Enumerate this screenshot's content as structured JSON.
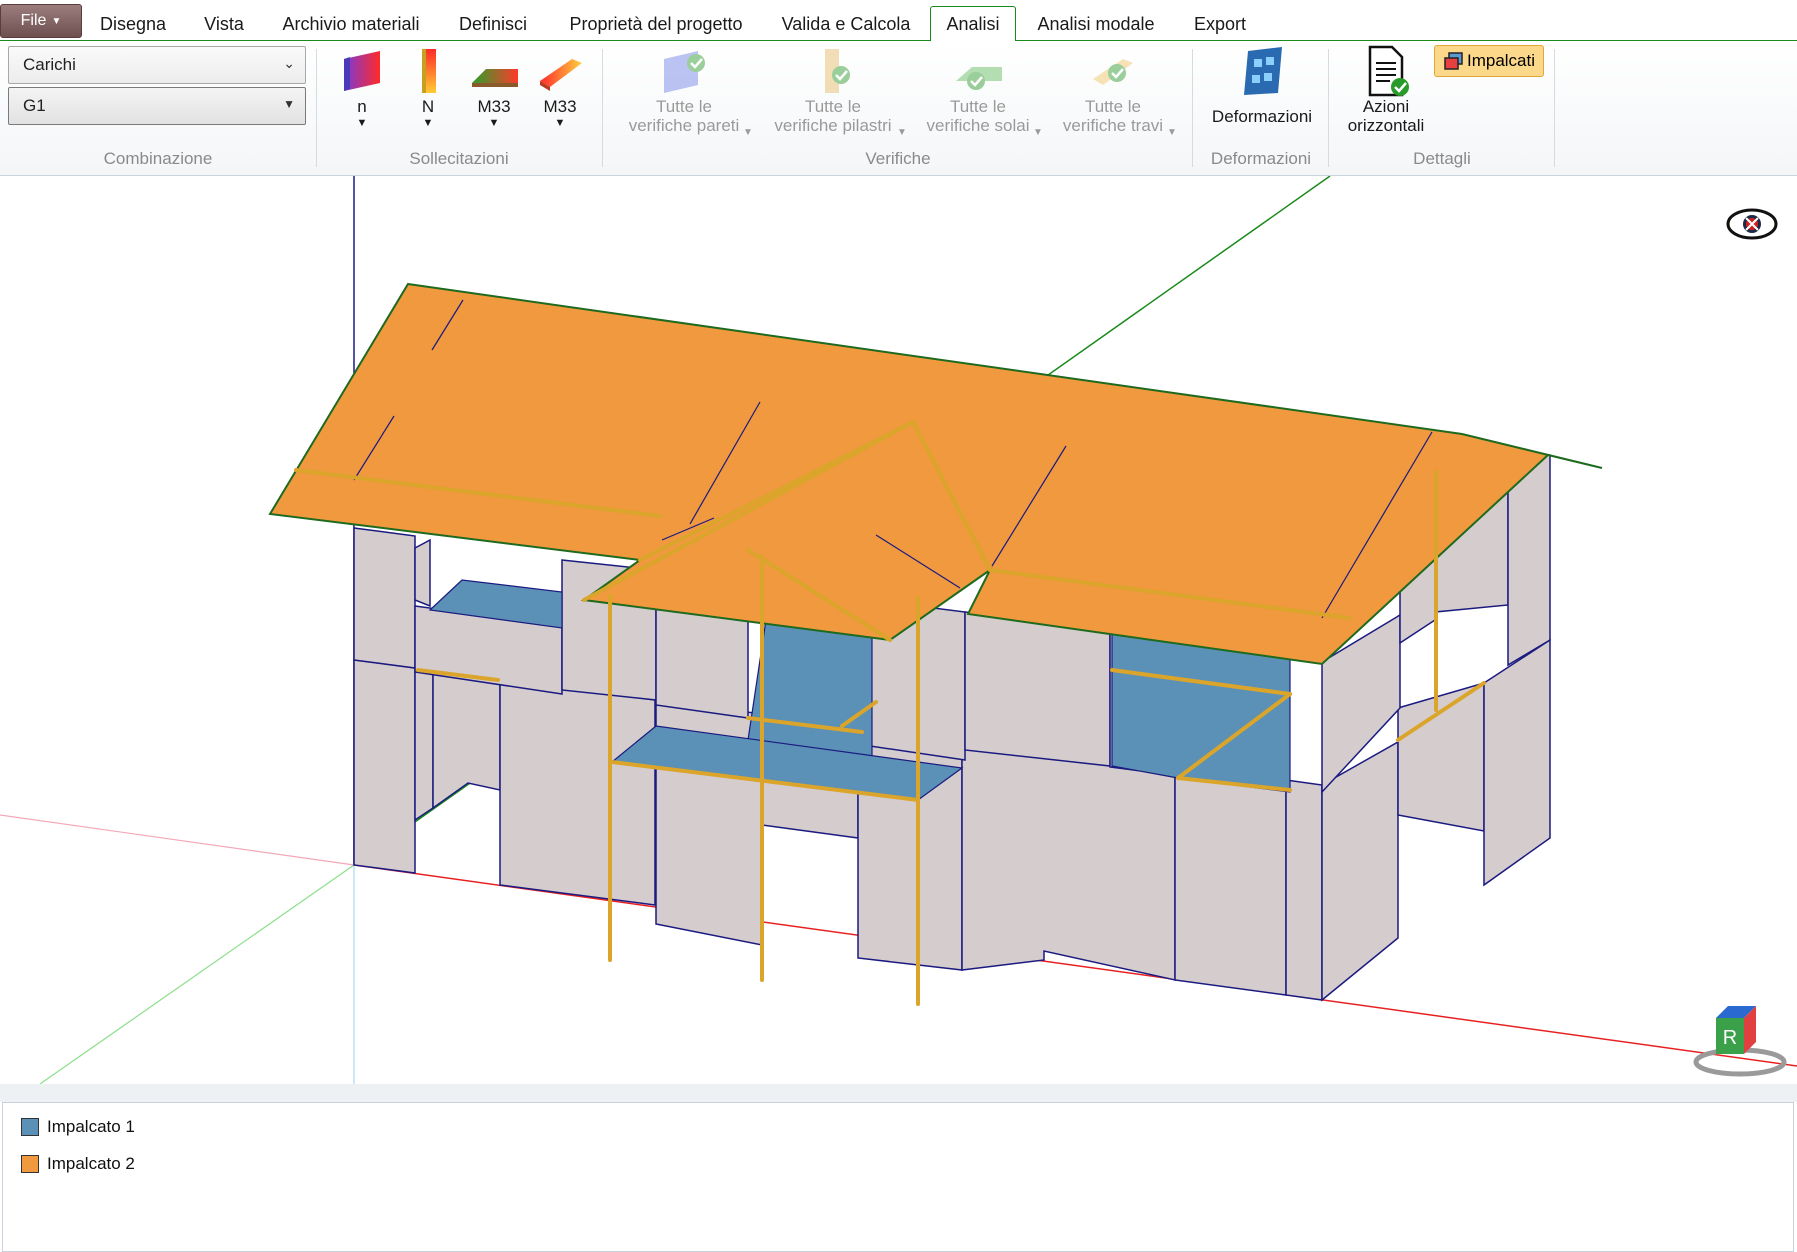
{
  "tabs": {
    "file_label": "File",
    "items": [
      {
        "label": "Disegna"
      },
      {
        "label": "Vista"
      },
      {
        "label": "Archivio materiali"
      },
      {
        "label": "Definisci"
      },
      {
        "label": "Proprietà del progetto"
      },
      {
        "label": "Valida e Calcola"
      },
      {
        "label": "Analisi",
        "active": true
      },
      {
        "label": "Analisi modale"
      },
      {
        "label": "Export"
      }
    ]
  },
  "ribbon": {
    "combinazione": {
      "group_label": "Combinazione",
      "load_type_value": "Carichi",
      "combination_value": "G1"
    },
    "sollecitazioni": {
      "group_label": "Sollecitazioni",
      "buttons": [
        {
          "label": "n",
          "icon": "stress-n-icon"
        },
        {
          "label": "N",
          "icon": "stress-N-icon"
        },
        {
          "label": "M33",
          "icon": "stress-m33-slab-icon"
        },
        {
          "label": "M33",
          "icon": "stress-m33-beam-icon"
        }
      ]
    },
    "verifiche": {
      "group_label": "Verifiche",
      "buttons": [
        {
          "line1": "Tutte le",
          "line2": "verifiche pareti",
          "disabled": true
        },
        {
          "line1": "Tutte le",
          "line2": "verifiche pilastri",
          "disabled": true
        },
        {
          "line1": "Tutte le",
          "line2": "verifiche solai",
          "disabled": true
        },
        {
          "line1": "Tutte le",
          "line2": "verifiche travi",
          "disabled": true
        }
      ]
    },
    "deformazioni": {
      "group_label": "Deformazioni",
      "button_label": "Deformazioni"
    },
    "dettagli": {
      "group_label": "Dettagli",
      "azioni_line1": "Azioni",
      "azioni_line2": "orizzontali",
      "impalcati_label": "Impalcati"
    }
  },
  "viewport": {
    "view_cube_label": "R",
    "colors": {
      "impalcato_1": "#5b91b6",
      "impalcato_2": "#f0993e",
      "wall": "#d5cdcd",
      "beam": "#dba42a",
      "edge": "#1a1a80"
    }
  },
  "legend": {
    "items": [
      {
        "label": "Impalcato 1",
        "color": "#5b91b6"
      },
      {
        "label": "Impalcato 2",
        "color": "#f0993e"
      }
    ]
  }
}
